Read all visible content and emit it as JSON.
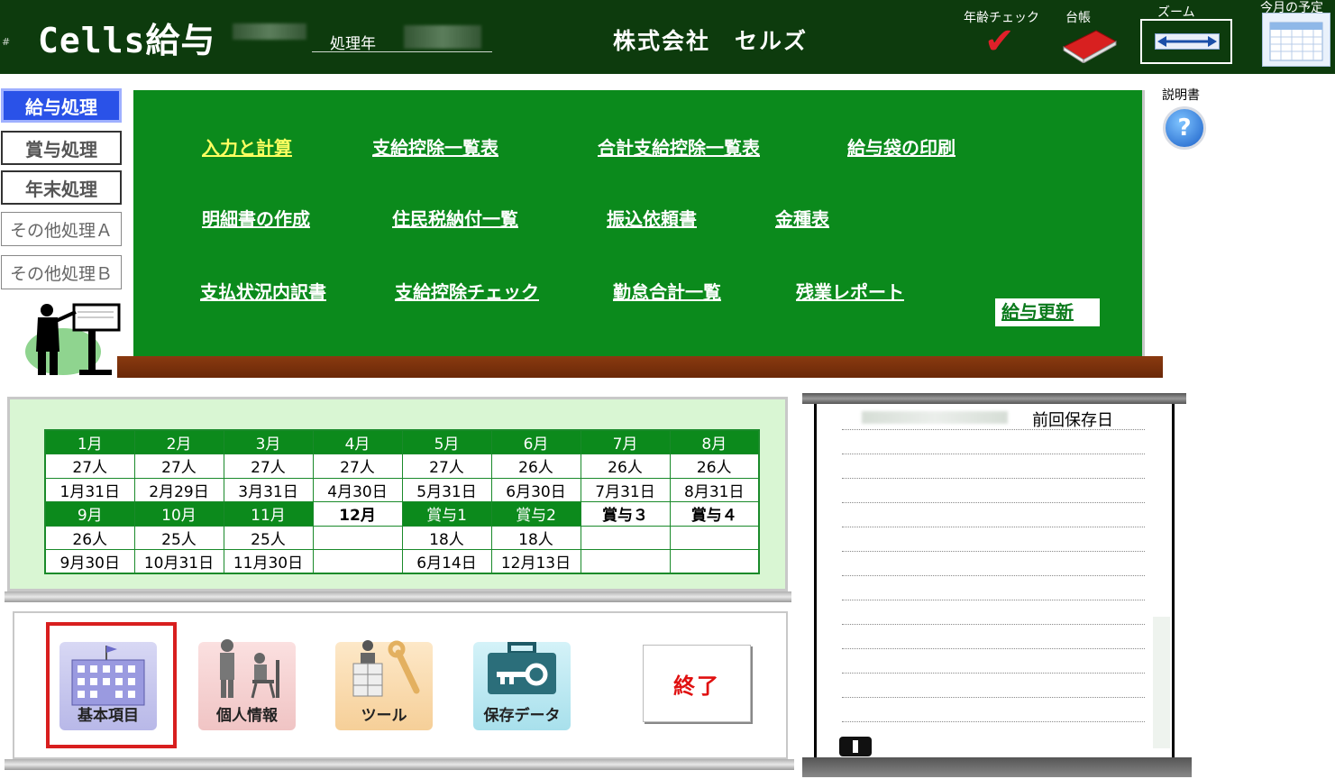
{
  "header": {
    "app_title": "Cells給与",
    "year_label": "処理年",
    "company": "株式会社　セルズ",
    "age_check_label": "年齢チェック",
    "ledger_label": "台帳",
    "zoom_label": "ズーム",
    "schedule_label": "今月の予定"
  },
  "side_tabs": [
    {
      "label": "給与処理",
      "active": true
    },
    {
      "label": "賞与処理"
    },
    {
      "label": "年末処理"
    },
    {
      "label": "その他処理Ａ"
    },
    {
      "label": "その他処理Ｂ"
    }
  ],
  "board": {
    "links": [
      {
        "label": "入力と計算",
        "active": true
      },
      {
        "label": "支給控除一覧表"
      },
      {
        "label": "合計支給控除一覧表"
      },
      {
        "label": "給与袋の印刷"
      },
      {
        "label": "明細書の作成"
      },
      {
        "label": "住民税納付一覧"
      },
      {
        "label": "振込依頼書"
      },
      {
        "label": "金種表"
      },
      {
        "label": "支払状況内訳書"
      },
      {
        "label": "支給控除チェック"
      },
      {
        "label": "勤怠合計一覧"
      },
      {
        "label": "残業レポート"
      }
    ],
    "update_button": "給与更新"
  },
  "help": {
    "label": "説明書",
    "icon": "?"
  },
  "months": {
    "row1": {
      "headers": [
        "1月",
        "2月",
        "3月",
        "4月",
        "5月",
        "6月",
        "7月",
        "8月"
      ],
      "counts": [
        "27人",
        "27人",
        "27人",
        "27人",
        "27人",
        "26人",
        "26人",
        "26人"
      ],
      "dates": [
        "1月31日",
        "2月29日",
        "3月31日",
        "4月30日",
        "5月31日",
        "6月30日",
        "7月31日",
        "8月31日"
      ]
    },
    "row2": {
      "headers": [
        "9月",
        "10月",
        "11月",
        "12月",
        "賞与1",
        "賞与2",
        "賞与３",
        "賞与４"
      ],
      "counts": [
        "26人",
        "25人",
        "25人",
        "",
        "18人",
        "18人",
        "",
        ""
      ],
      "dates": [
        "9月30日",
        "10月31日",
        "11月30日",
        "",
        "6月14日",
        "12月13日",
        "",
        ""
      ]
    }
  },
  "tools": {
    "basic": "基本項目",
    "personal": "個人情報",
    "tool": "ツール",
    "save": "保存データ",
    "end": "終了"
  },
  "save_log": {
    "title": "前回保存日"
  },
  "colors": {
    "header_bg": "#0d3b0d",
    "board_green": "#0b8a1c",
    "active_tab": "#2a52e8",
    "active_link": "#ffff60",
    "end_red": "#e01010"
  }
}
